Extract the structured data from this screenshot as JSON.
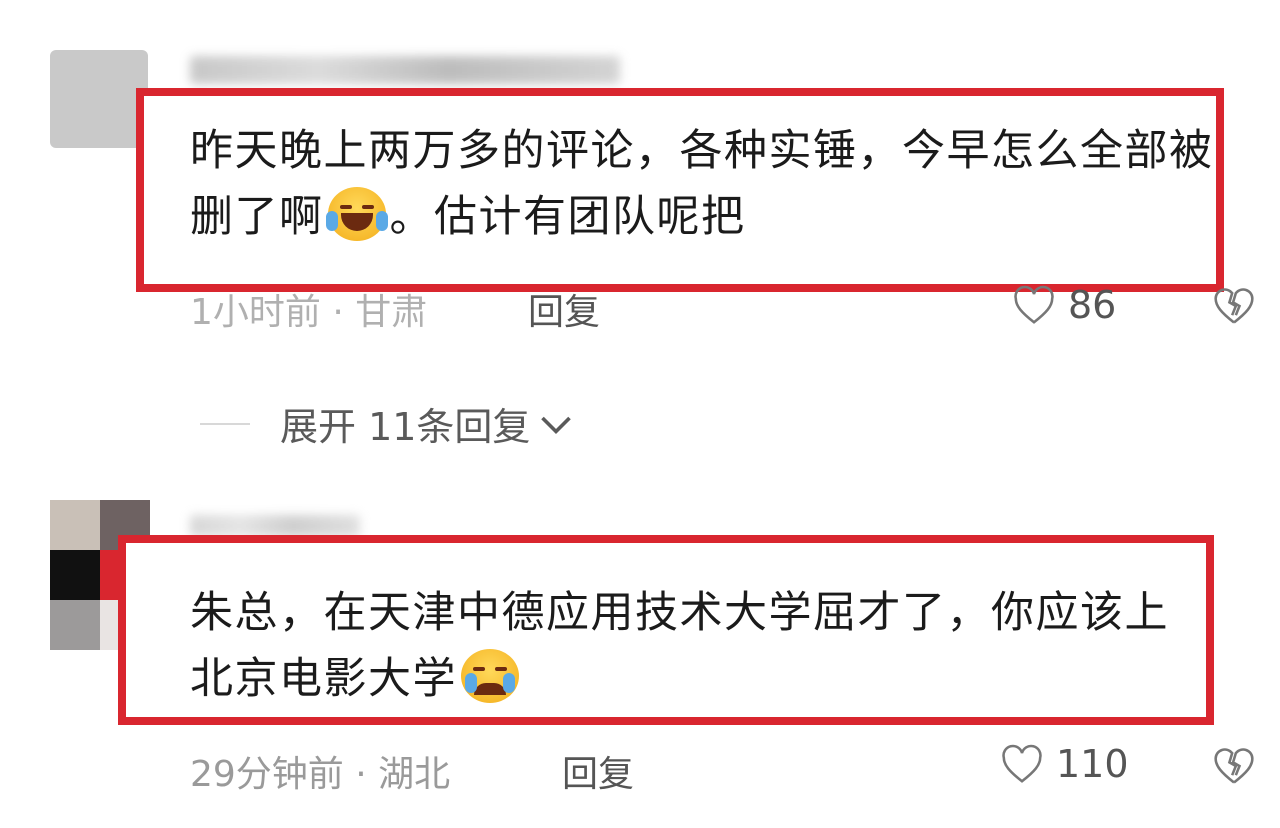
{
  "comments": [
    {
      "text_part1": "昨天晚上两万多的评论，各种实锤，今早怎么全部被删了啊",
      "emoji": "laughing-tears-emoji",
      "text_part2": "。估计有团队呢把",
      "meta": "1小时前 · 甘肃",
      "reply_label": "回复",
      "likes": "86"
    },
    {
      "text_part1": "朱总，在天津中德应用技术大学屈才了，你应该上北京电影大学",
      "emoji": "crying-emoji",
      "text_part2": "",
      "meta": "29分钟前 · 湖北",
      "reply_label": "回复",
      "likes": "110"
    }
  ],
  "expand": {
    "label": "展开 11条回复"
  },
  "colors": {
    "highlight": "#d9262f",
    "meta": "#9a9a9a"
  }
}
